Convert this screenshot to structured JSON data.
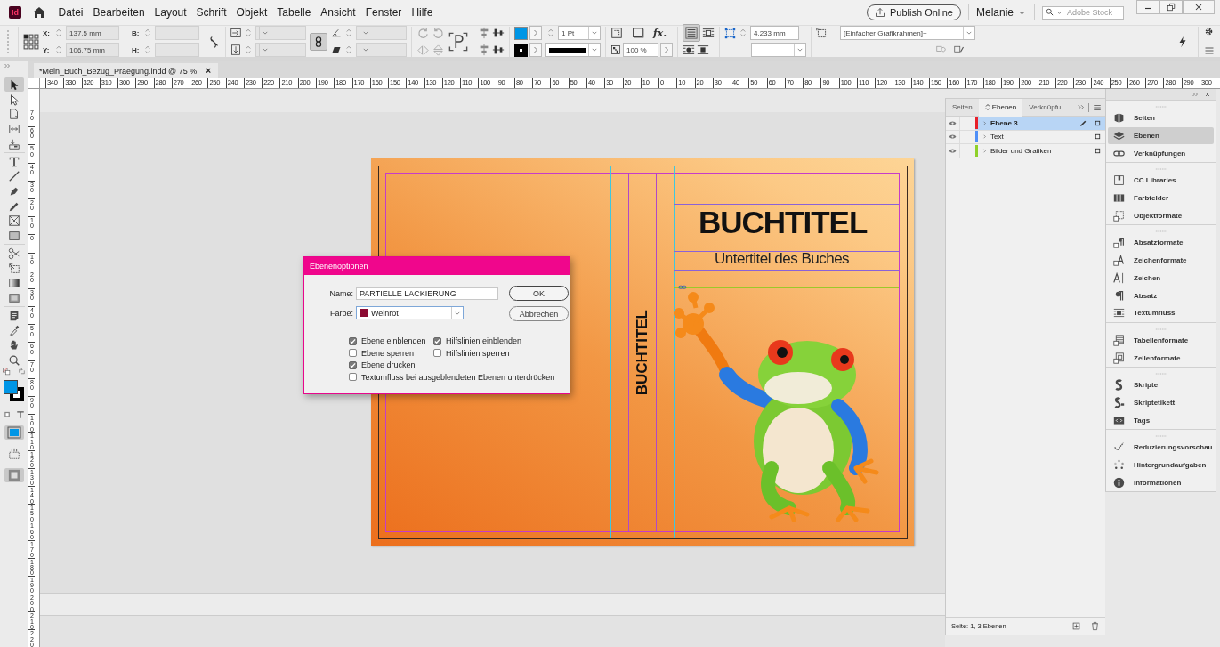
{
  "app_logo": "Id",
  "menu": [
    "Datei",
    "Bearbeiten",
    "Layout",
    "Schrift",
    "Objekt",
    "Tabelle",
    "Ansicht",
    "Fenster",
    "Hilfe"
  ],
  "publish_button": "Publish Online",
  "user_menu": "Melanie",
  "stock_search": {
    "placeholder": "Adobe Stock"
  },
  "control_bar": {
    "x": {
      "label": "X:",
      "value": "137,5 mm"
    },
    "y": {
      "label": "Y:",
      "value": "106,75 mm"
    },
    "width": {
      "label": "B:"
    },
    "height": {
      "label": "H:"
    },
    "stroke_weight": "1 Pt",
    "effects": "fx.",
    "opacity": "100 %",
    "offset": "4,233 mm",
    "object_style": "[Einfacher Grafikrahmen]+"
  },
  "document_tab": {
    "title": "*Mein_Buch_Bezug_Praegung.indd @ 75 %",
    "close": "×"
  },
  "horizontal_ruler": [
    "340",
    "330",
    "320",
    "310",
    "300",
    "290",
    "280",
    "270",
    "260",
    "250",
    "240",
    "230",
    "220",
    "210",
    "200",
    "190",
    "180",
    "170",
    "160",
    "150",
    "140",
    "130",
    "120",
    "110",
    "100",
    "90",
    "80",
    "70",
    "60",
    "50",
    "40",
    "30",
    "20",
    "10",
    "0",
    "10",
    "20",
    "30",
    "40",
    "50",
    "60",
    "70",
    "80",
    "90",
    "100",
    "110",
    "120",
    "130",
    "140",
    "150",
    "160",
    "170",
    "180",
    "190",
    "200",
    "210",
    "220",
    "230",
    "240",
    "250",
    "260",
    "270",
    "280",
    "290",
    "300"
  ],
  "vertical_ruler": [
    "70",
    "60",
    "50",
    "40",
    "30",
    "20",
    "10",
    "0",
    "10",
    "20",
    "30",
    "40",
    "50",
    "60",
    "70",
    "80",
    "90",
    "100",
    "110",
    "120",
    "130",
    "140",
    "150",
    "160",
    "170",
    "180",
    "190",
    "200",
    "210",
    "220"
  ],
  "tools": [
    {
      "kind": "selection",
      "selected": true
    },
    {
      "kind": "direct-selection",
      "selected": false
    },
    {
      "kind": "page",
      "selected": false
    },
    {
      "kind": "gap",
      "selected": false
    },
    {
      "kind": "collector",
      "selected": false
    },
    {
      "kind": "type",
      "selected": false
    },
    {
      "kind": "line",
      "selected": false
    },
    {
      "kind": "pen",
      "selected": false
    },
    {
      "kind": "pencil",
      "selected": false
    },
    {
      "kind": "frame",
      "selected": false
    },
    {
      "kind": "rectangle",
      "selected": false
    },
    {
      "kind": "scissors",
      "selected": false
    },
    {
      "kind": "transform",
      "selected": false
    },
    {
      "kind": "gradient",
      "selected": false
    },
    {
      "kind": "feather",
      "selected": false
    },
    {
      "kind": "note",
      "selected": false
    },
    {
      "kind": "eyedropper",
      "selected": false
    },
    {
      "kind": "hand",
      "selected": false
    },
    {
      "kind": "zoom",
      "selected": false
    }
  ],
  "document": {
    "title": "BUCHTITEL",
    "subtitle": "Untertitel des Buches",
    "spine_title": "BUCHTITEL"
  },
  "dialog": {
    "title": "Ebenenoptionen",
    "name": {
      "label": "Name:",
      "value": "PARTIELLE LACKIERUNG"
    },
    "color": {
      "label": "Farbe:",
      "value": "Weinrot",
      "color": "#8b0a32"
    },
    "buttons": [
      "OK",
      "Abbrechen"
    ],
    "options": [
      {
        "label": "Ebene einblenden",
        "checked": true
      },
      {
        "label": "Hilfslinien einblenden",
        "checked": true
      },
      {
        "label": "Ebene sperren",
        "checked": false
      },
      {
        "label": "Hilfslinien sperren",
        "checked": false
      },
      {
        "label": "Ebene drucken",
        "checked": true
      },
      {
        "label": "Textumfluss bei ausgeblendeten Ebenen unterdrücken",
        "checked": false
      }
    ]
  },
  "layers_panel": {
    "tabs": [
      {
        "label": "Seiten",
        "selected": false
      },
      {
        "label": "Ebenen",
        "selected": true
      },
      {
        "label": "Verknüpfu",
        "selected": false
      }
    ],
    "layers": [
      {
        "name": "Ebene 3",
        "color": "#e8202a",
        "selected": true,
        "visible": true,
        "target": true
      },
      {
        "name": "Text",
        "color": "#4f8ff7",
        "selected": false,
        "visible": true,
        "target": false
      },
      {
        "name": "Bilder und Grafiken",
        "color": "#8fd12a",
        "selected": false,
        "visible": true,
        "target": false
      }
    ],
    "status": "Seite: 1, 3 Ebenen"
  },
  "dock": [
    [
      {
        "label": "Seiten",
        "kind": "pages",
        "selected": false
      },
      {
        "label": "Ebenen",
        "kind": "layers",
        "selected": true
      },
      {
        "label": "Verknüpfungen",
        "kind": "links",
        "selected": false
      }
    ],
    [
      {
        "label": "CC Libraries",
        "kind": "libraries",
        "selected": false
      },
      {
        "label": "Farbfelder",
        "kind": "swatches",
        "selected": false
      },
      {
        "label": "Objektformate",
        "kind": "object-styles",
        "selected": false
      }
    ],
    [
      {
        "label": "Absatzformate",
        "kind": "paragraph-styles",
        "selected": false
      },
      {
        "label": "Zeichenformate",
        "kind": "character-styles",
        "selected": false
      },
      {
        "label": "Zeichen",
        "kind": "character",
        "selected": false
      },
      {
        "label": "Absatz",
        "kind": "paragraph",
        "selected": false
      },
      {
        "label": "Textumfluss",
        "kind": "text-wrap",
        "selected": false
      }
    ],
    [
      {
        "label": "Tabellenformate",
        "kind": "table-styles",
        "selected": false
      },
      {
        "label": "Zellenformate",
        "kind": "cell-styles",
        "selected": false
      }
    ],
    [
      {
        "label": "Skripte",
        "kind": "scripts",
        "selected": false
      },
      {
        "label": "Skriptetikett",
        "kind": "script-label",
        "selected": false
      },
      {
        "label": "Tags",
        "kind": "tags",
        "selected": false
      }
    ],
    [
      {
        "label": "Reduzierungsvorschau",
        "kind": "flattener",
        "selected": false
      },
      {
        "label": "Hintergrundaufgaben",
        "kind": "background-tasks",
        "selected": false
      },
      {
        "label": "Informationen",
        "kind": "info",
        "selected": false
      }
    ]
  ]
}
